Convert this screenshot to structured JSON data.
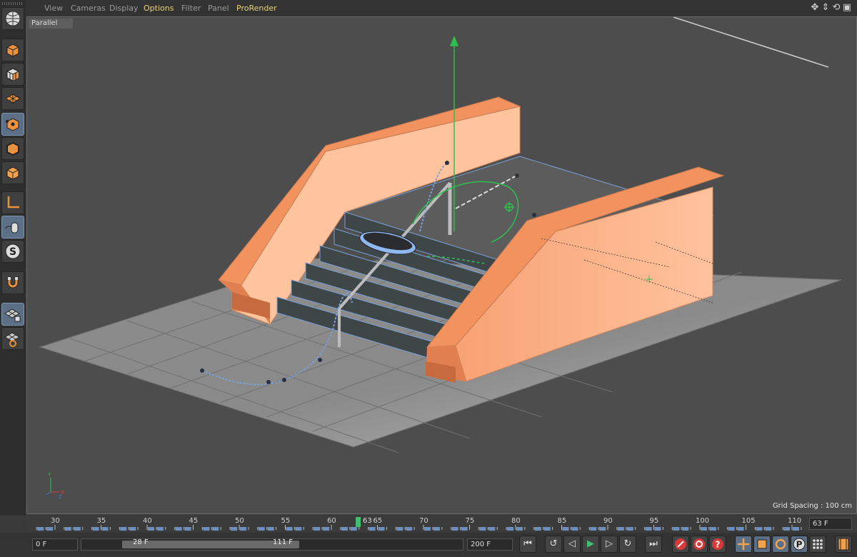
{
  "menu": {
    "items": [
      "View",
      "Cameras",
      "Display",
      "Options",
      "Filter",
      "Panel",
      "ProRender"
    ]
  },
  "viewport": {
    "camera_label": "Parallel",
    "grid_spacing": "Grid Spacing : 100 cm",
    "axis": {
      "x": "X",
      "y": "Y",
      "z": "Z"
    }
  },
  "timeline": {
    "tick_labels": [
      "30",
      "35",
      "40",
      "45",
      "50",
      "55",
      "60",
      "65",
      "70",
      "75",
      "80",
      "85",
      "90",
      "95",
      "100",
      "105",
      "110"
    ],
    "current_marker": "63",
    "current_frame": "63 F"
  },
  "transport": {
    "start_frame": "0 F",
    "range_start": "28 F",
    "range_end": "111 F",
    "end_frame": "200 F"
  },
  "colors": {
    "viewport_bg": "#4d4d4d",
    "floor": "#8a8a8a",
    "wall_orange": "#f4a070",
    "wall_light": "#ffc49e",
    "stairs": "#40494c",
    "selection_blue": "#7aa0d6",
    "axis_green": "#2fbf4f",
    "accent_menu": "#e8d27a"
  },
  "icons": {
    "menu": [
      "move-icon",
      "zoom-icon",
      "rotate-icon",
      "maximize-icon"
    ],
    "left_toolbar": [
      "cube-icon",
      "checker-cube-icon",
      "polygon-grid-icon",
      "point-mode-icon",
      "edge-mode-icon",
      "polygon-mode-icon",
      "axis-icon",
      "tweak-mode-icon",
      "snap-icon",
      "magnet-icon",
      "workplane-lock-icon",
      "workplane-icon"
    ]
  }
}
